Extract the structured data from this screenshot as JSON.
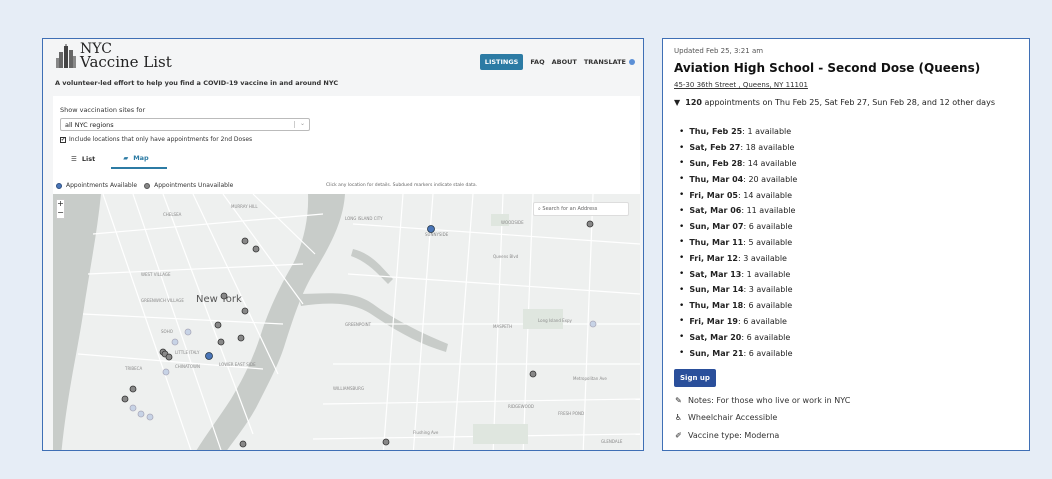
{
  "app": {
    "logo_line1": "NYC",
    "logo_line2": "Vaccine List",
    "tagline": "A volunteer-led effort to help you find a COVID-19 vaccine in and around NYC",
    "nav": [
      "LISTINGS",
      "FAQ",
      "ABOUT",
      "TRANSLATE"
    ],
    "brand_color": "#2c7ba4"
  },
  "filters": {
    "show_label": "Show vaccination sites for",
    "region_value": "all NYC regions",
    "second_dose_label": "Include locations that only have appointments for 2nd Doses",
    "second_dose_checked": true
  },
  "tabs": {
    "list": "List",
    "map": "Map",
    "active": "Map"
  },
  "legend": {
    "available": "Appointments Available",
    "unavailable": "Appointments Unavailable",
    "hint": "Click any location for details. Subdued markers indicate stale data.",
    "available_color": "#4a76b8",
    "unavailable_color": "#888888"
  },
  "map": {
    "search_placeholder": "Search for an Address",
    "city_label": "New York",
    "zoom_in": "+",
    "zoom_out": "−",
    "street_labels": [
      "CHELSEA",
      "MURRAY HILL",
      "LONG ISLAND CITY",
      "SUNNYSIDE",
      "WOODSIDE",
      "WEST VILLAGE",
      "GREENWICH VILLAGE",
      "SOHO",
      "LITTLE ITALY",
      "TRIBECA",
      "CHINATOWN",
      "LOWER EAST SIDE",
      "GREENPOINT",
      "MASPETH",
      "WILLIAMSBURG",
      "RIDGEWOOD",
      "FRESH POND",
      "GLENDALE",
      "Queens Blvd",
      "Long Island Expy",
      "Metropolitan Ave",
      "Flushing Ave"
    ]
  },
  "details": {
    "updated": "Updated Feb 25, 3:21 am",
    "name": "Aviation High School - Second Dose (Queens)",
    "address": "45-30 36th Street , Queens, NY 11101",
    "count": "120",
    "summary_rest": "appointments on Thu Feb 25, Sat Feb 27, Sun Feb 28, and 12 other days",
    "dates": [
      {
        "day": "Thu, Feb 25",
        "avail": ": 1 available"
      },
      {
        "day": "Sat, Feb 27",
        "avail": ": 18 available"
      },
      {
        "day": "Sun, Feb 28",
        "avail": ": 14 available"
      },
      {
        "day": "Thu, Mar 04",
        "avail": ": 20 available"
      },
      {
        "day": "Fri, Mar 05",
        "avail": ": 14 available"
      },
      {
        "day": "Sat, Mar 06",
        "avail": ": 11 available"
      },
      {
        "day": "Sun, Mar 07",
        "avail": ": 6 available"
      },
      {
        "day": "Thu, Mar 11",
        "avail": ": 5 available"
      },
      {
        "day": "Fri, Mar 12",
        "avail": ": 3 available"
      },
      {
        "day": "Sat, Mar 13",
        "avail": ": 1 available"
      },
      {
        "day": "Sun, Mar 14",
        "avail": ": 3 available"
      },
      {
        "day": "Thu, Mar 18",
        "avail": ": 6 available"
      },
      {
        "day": "Fri, Mar 19",
        "avail": ": 6 available"
      },
      {
        "day": "Sat, Mar 20",
        "avail": ": 6 available"
      },
      {
        "day": "Sun, Mar 21",
        "avail": ": 6 available"
      }
    ],
    "signup": "Sign up",
    "notes": "Notes: For those who live or work in NYC",
    "wheelchair": "Wheelchair Accessible",
    "vaccine": "Vaccine type: Moderna",
    "signup_color": "#2a4f9b"
  }
}
